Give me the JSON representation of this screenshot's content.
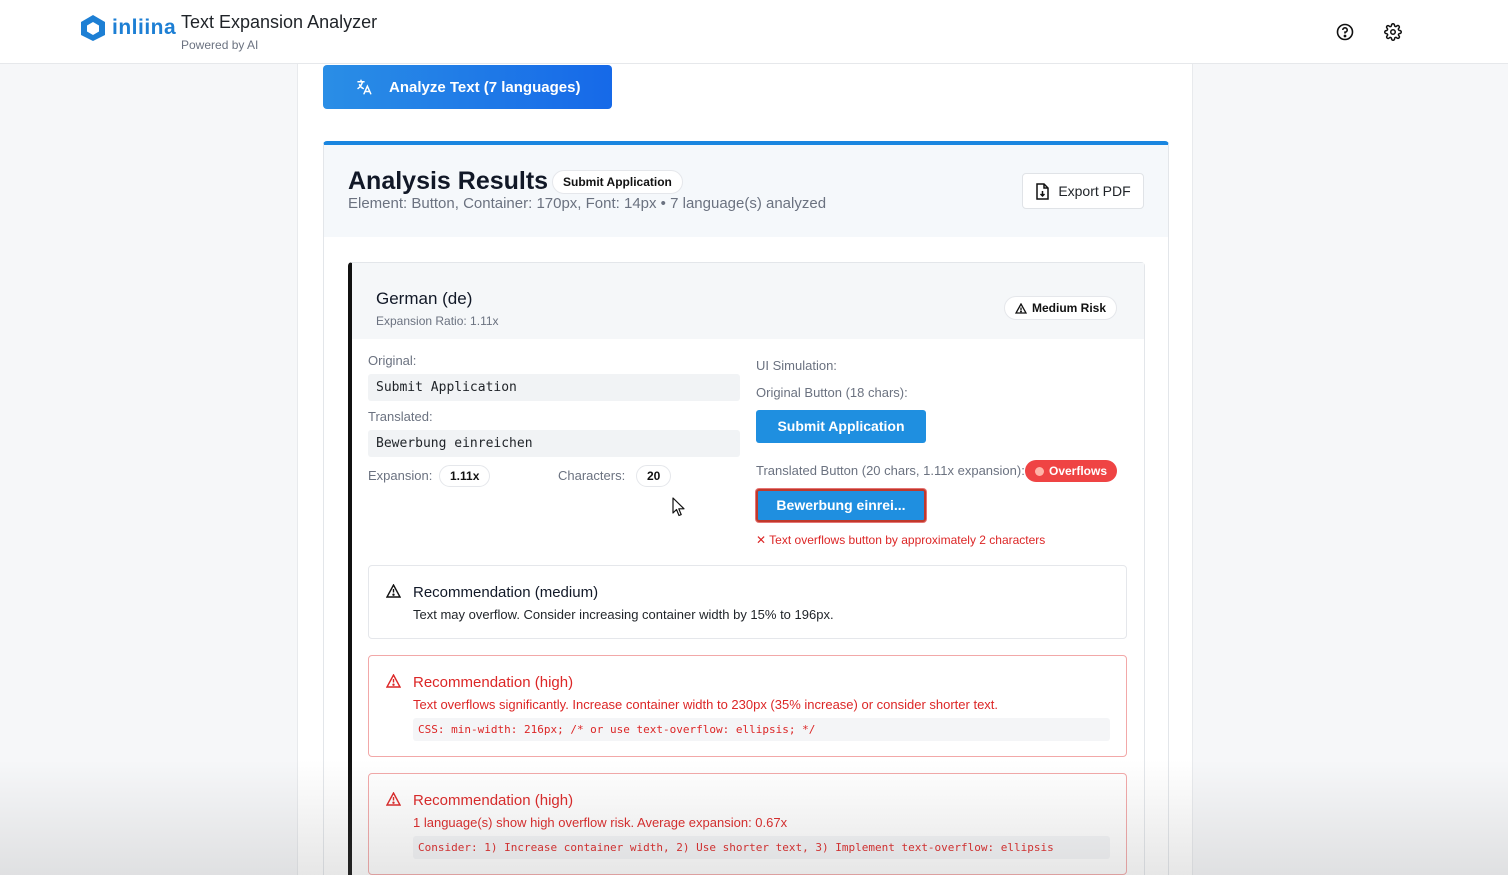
{
  "header": {
    "brand": "inliina",
    "title": "Text Expansion Analyzer",
    "subtitle": "Powered by AI",
    "help_icon": "help-circle-icon",
    "settings_icon": "gear-icon"
  },
  "analyze_button": {
    "label": "Analyze Text (7 languages)",
    "icon": "translate-icon"
  },
  "results": {
    "title": "Analysis Results",
    "tag": "Submit Application",
    "meta": "Element: Button, Container: 170px, Font: 14px • 7 language(s) analyzed",
    "export_label": "Export PDF"
  },
  "language": {
    "name": "German (de)",
    "ratio": "Expansion Ratio: 1.11x",
    "risk": "Medium Risk",
    "original_label": "Original:",
    "original_text": "Submit Application",
    "translated_label": "Translated:",
    "translated_text": "Bewerbung einreichen",
    "expansion_label": "Expansion:",
    "expansion_value": "1.11x",
    "characters_label": "Characters:",
    "characters_value": "20",
    "sim": {
      "heading": "UI Simulation:",
      "original_label": "Original Button (18 chars):",
      "original_button": "Submit Application",
      "translated_label": "Translated Button (20 chars, 1.11x expansion):",
      "overflows_badge": "Overflows",
      "translated_button": "Bewerbung einrei...",
      "overflow_message": "✕ Text overflows button by approximately 2 characters"
    }
  },
  "recommendations": [
    {
      "title": "Recommendation (medium)",
      "text": "Text may overflow. Consider increasing container width by 15% to 196px.",
      "code": ""
    },
    {
      "title": "Recommendation (high)",
      "text": "Text overflows significantly. Increase container width to 230px (35% increase) or consider shorter text.",
      "code": "CSS: min-width: 216px; /* or use text-overflow: ellipsis; */"
    },
    {
      "title": "Recommendation (high)",
      "text": "1 language(s) show high overflow risk. Average expansion: 0.67x",
      "code": "Consider: 1) Increase container width, 2) Use shorter text, 3) Implement text-overflow: ellipsis"
    }
  ],
  "colors": {
    "accent": "#1a86e0",
    "danger": "#dc2626",
    "badge_danger": "#ef4444"
  }
}
